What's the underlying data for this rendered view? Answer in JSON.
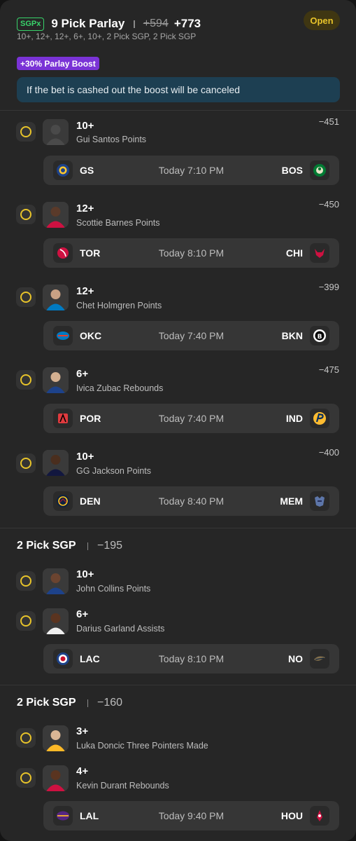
{
  "header": {
    "badge": "SGPx",
    "title": "9 Pick Parlay",
    "old_odds": "+594",
    "new_odds": "+773",
    "subtitle": "10+, 12+, 12+, 6+, 10+, 2 Pick SGP, 2 Pick SGP",
    "status": "Open"
  },
  "boost": {
    "label": "+30% Parlay Boost",
    "notice": "If the bet is cashed out the boost will be canceled"
  },
  "legs": [
    {
      "line": "10+",
      "desc": "Gui Santos Points",
      "odds": "−451",
      "game": {
        "away": "GS",
        "time": "Today 7:10 PM",
        "home": "BOS"
      }
    },
    {
      "line": "12+",
      "desc": "Scottie Barnes Points",
      "odds": "−450",
      "game": {
        "away": "TOR",
        "time": "Today 8:10 PM",
        "home": "CHI"
      }
    },
    {
      "line": "12+",
      "desc": "Chet Holmgren Points",
      "odds": "−399",
      "game": {
        "away": "OKC",
        "time": "Today 7:40 PM",
        "home": "BKN"
      }
    },
    {
      "line": "6+",
      "desc": "Ivica Zubac Rebounds",
      "odds": "−475",
      "game": {
        "away": "POR",
        "time": "Today 7:40 PM",
        "home": "IND"
      }
    },
    {
      "line": "10+",
      "desc": "GG Jackson Points",
      "odds": "−400",
      "game": {
        "away": "DEN",
        "time": "Today 8:40 PM",
        "home": "MEM"
      }
    }
  ],
  "sgps": [
    {
      "title": "2 Pick SGP",
      "odds": "−195",
      "picks": [
        {
          "line": "10+",
          "desc": "John Collins Points"
        },
        {
          "line": "6+",
          "desc": "Darius Garland Assists"
        }
      ],
      "game": {
        "away": "LAC",
        "time": "Today 8:10 PM",
        "home": "NO"
      }
    },
    {
      "title": "2 Pick SGP",
      "odds": "−160",
      "picks": [
        {
          "line": "3+",
          "desc": "Luka Doncic Three Pointers Made"
        },
        {
          "line": "4+",
          "desc": "Kevin Durant Rebounds"
        }
      ],
      "game": {
        "away": "LAL",
        "time": "Today 9:40 PM",
        "home": "HOU"
      }
    }
  ],
  "colors": {
    "accent_yellow": "#e8c42a",
    "sgpx_green": "#38d26a",
    "boost_purple": "#7a33d6",
    "notice_bg": "#1d3f52"
  }
}
